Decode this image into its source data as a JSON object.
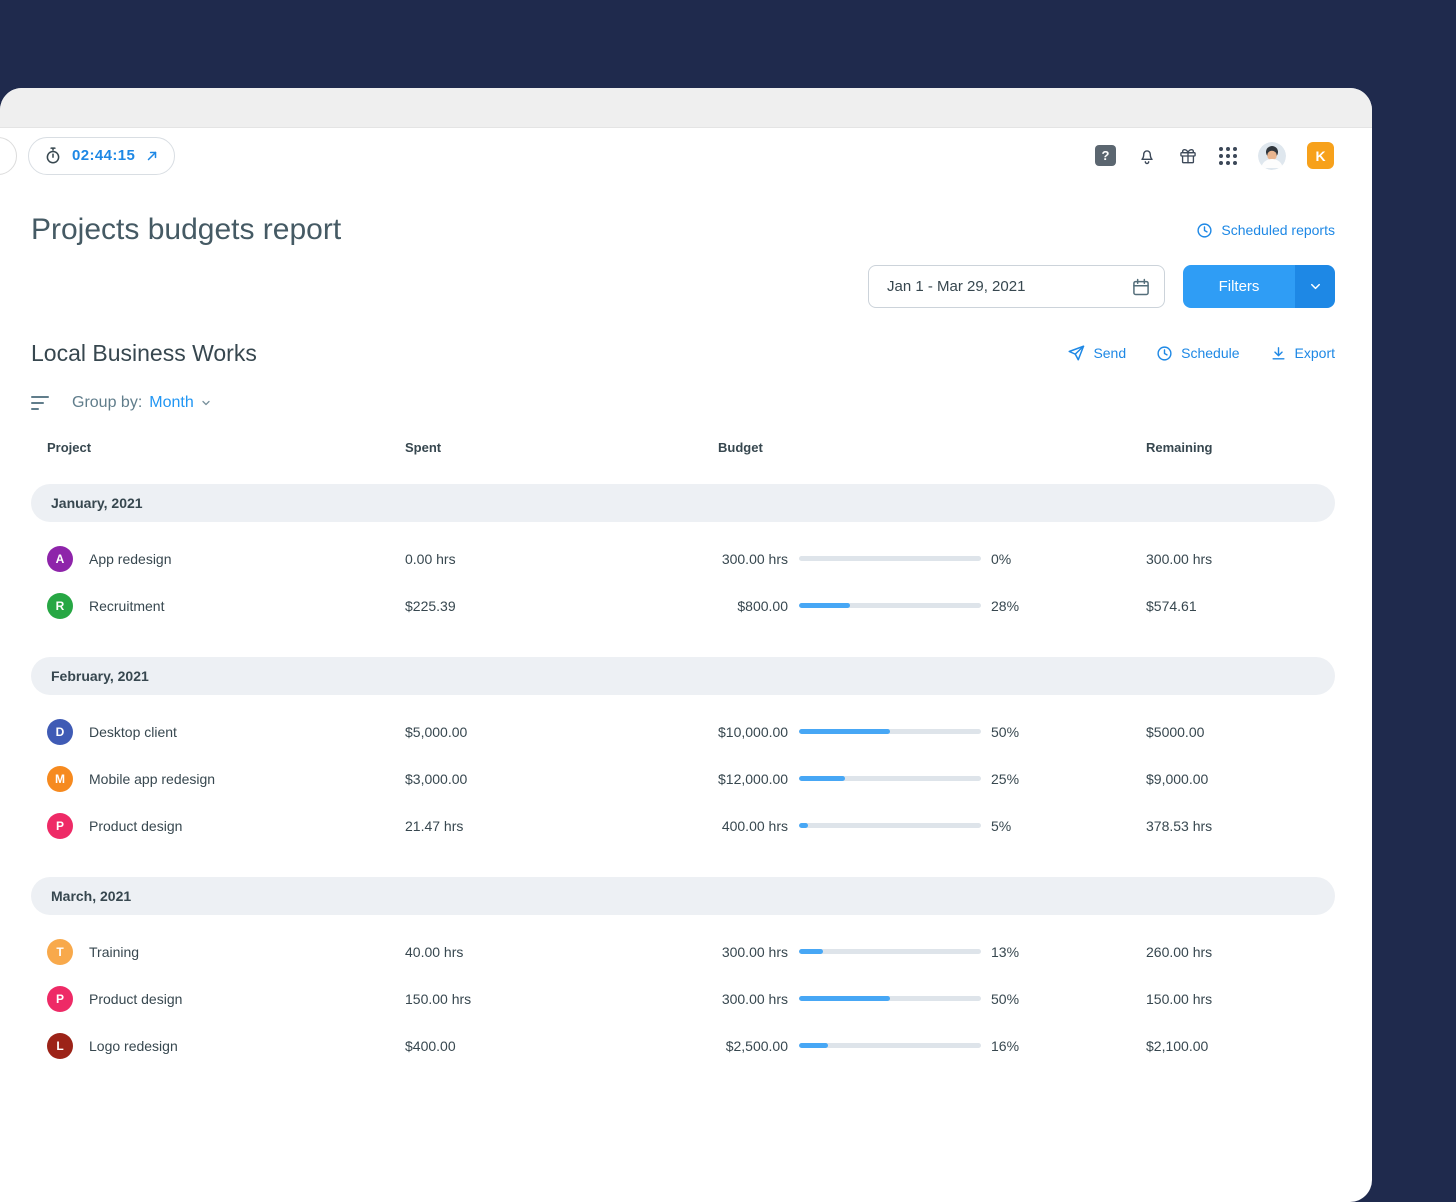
{
  "topbar": {
    "timer": "02:44:15",
    "user_initial": "K"
  },
  "header": {
    "title": "Projects budgets report",
    "scheduled_reports": "Scheduled reports",
    "date_range": "Jan 1 - Mar 29, 2021",
    "filters_label": "Filters"
  },
  "report": {
    "client": "Local Business Works",
    "actions": {
      "send": "Send",
      "schedule": "Schedule",
      "export": "Export"
    },
    "group_by_label": "Group by:",
    "group_by_value": "Month",
    "columns": [
      "Project",
      "Spent",
      "Budget",
      "Remaining"
    ],
    "groups": [
      {
        "label": "January, 2021",
        "rows": [
          {
            "initial": "A",
            "color": "#8E24AA",
            "project": "App redesign",
            "spent": "0.00 hrs",
            "budget": "300.00 hrs",
            "percent": 0,
            "percent_label": "0%",
            "remaining": "300.00 hrs"
          },
          {
            "initial": "R",
            "color": "#27A744",
            "project": "Recruitment",
            "spent": "$225.39",
            "budget": "$800.00",
            "percent": 28,
            "percent_label": "28%",
            "remaining": "$574.61"
          }
        ]
      },
      {
        "label": "February, 2021",
        "rows": [
          {
            "initial": "D",
            "color": "#3F5BB5",
            "project": "Desktop client",
            "spent": "$5,000.00",
            "budget": "$10,000.00",
            "percent": 50,
            "percent_label": "50%",
            "remaining": "$5000.00"
          },
          {
            "initial": "M",
            "color": "#F68A1F",
            "project": "Mobile app redesign",
            "spent": "$3,000.00",
            "budget": "$12,000.00",
            "percent": 25,
            "percent_label": "25%",
            "remaining": "$9,000.00"
          },
          {
            "initial": "P",
            "color": "#EE2A66",
            "project": "Product design",
            "spent": "21.47 hrs",
            "budget": "400.00 hrs",
            "percent": 5,
            "percent_label": "5%",
            "remaining": "378.53 hrs"
          }
        ]
      },
      {
        "label": "March, 2021",
        "rows": [
          {
            "initial": "T",
            "color": "#F8A94B",
            "project": "Training",
            "spent": "40.00 hrs",
            "budget": "300.00 hrs",
            "percent": 13,
            "percent_label": "13%",
            "remaining": "260.00 hrs"
          },
          {
            "initial": "P",
            "color": "#EE2A66",
            "project": "Product design",
            "spent": "150.00 hrs",
            "budget": "300.00 hrs",
            "percent": 50,
            "percent_label": "50%",
            "remaining": "150.00 hrs"
          },
          {
            "initial": "L",
            "color": "#9C2318",
            "project": "Logo redesign",
            "spent": "$400.00",
            "budget": "$2,500.00",
            "percent": 16,
            "percent_label": "16%",
            "remaining": "$2,100.00"
          }
        ]
      }
    ]
  },
  "colors": {
    "accent": "#1E88E5",
    "filters_button": "#2F9DF5",
    "progress_fill": "#47A7F5",
    "progress_track": "#DEE4EA",
    "group_bar": "#EDF0F4",
    "background": "#1F2A4D"
  }
}
